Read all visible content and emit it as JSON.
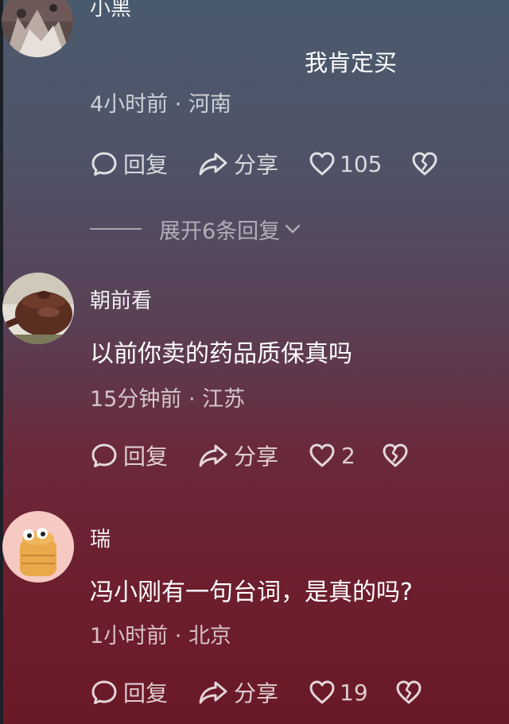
{
  "comments": [
    {
      "username": "小黑",
      "text": "我肯定买",
      "time": "4小时前",
      "location": "河南",
      "likes": "105",
      "reply_label": "回复",
      "share_label": "分享",
      "expand_label": "展开6条回复"
    },
    {
      "username": "朝前看",
      "text": "以前你卖的药品质保真吗",
      "time": "15分钟前",
      "location": "江苏",
      "likes": "2",
      "reply_label": "回复",
      "share_label": "分享"
    },
    {
      "username": "瑞",
      "text": "冯小刚有一句台词，是真的吗?",
      "time": "1小时前",
      "location": "北京",
      "likes": "19",
      "reply_label": "回复",
      "share_label": "分享"
    }
  ],
  "meta_separator": " · ",
  "icons": {
    "reply": "reply-bubble-icon",
    "share": "share-arrow-icon",
    "like": "heart-outline-icon",
    "dislike": "broken-heart-icon",
    "expand": "chevron-down-icon"
  }
}
